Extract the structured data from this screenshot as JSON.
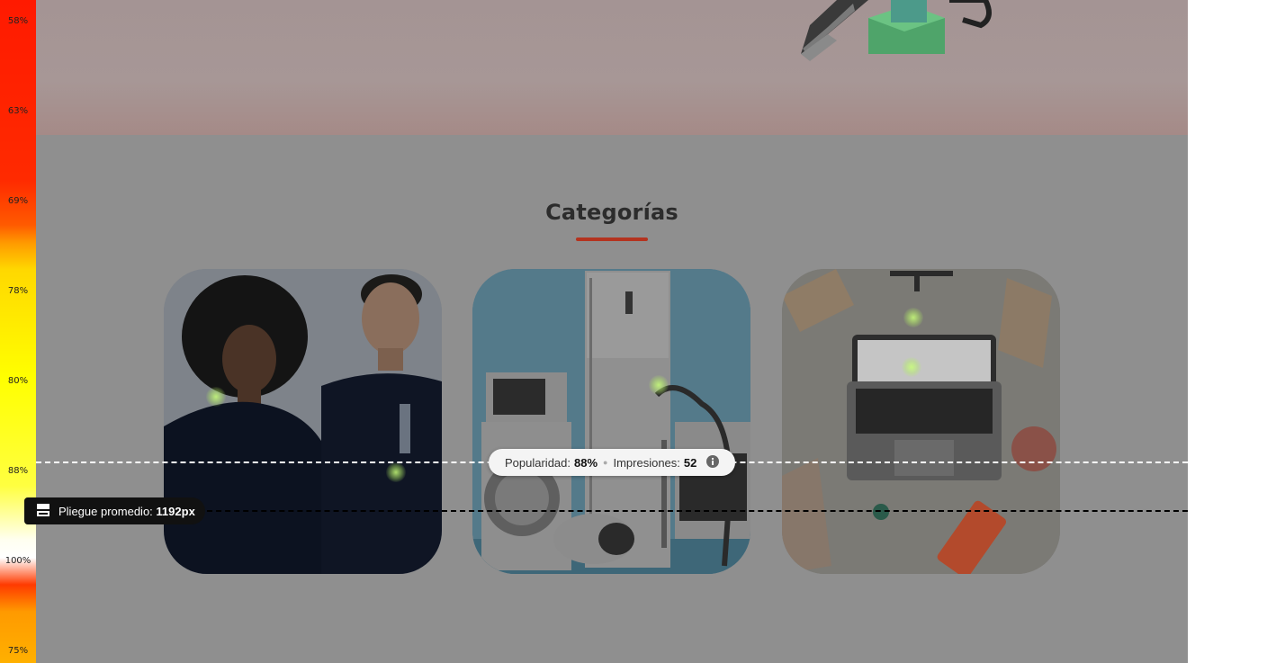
{
  "heatmap_scale": {
    "labels": [
      "58%",
      "63%",
      "69%",
      "78%",
      "80%",
      "88%",
      "100%",
      "75%"
    ]
  },
  "section": {
    "title": "Categorías",
    "accent_color": "#b4331f"
  },
  "categories": [
    {
      "image": "apparel-photo"
    },
    {
      "image": "home-appliances-photo"
    },
    {
      "image": "laptop-electronics-photo"
    }
  ],
  "fold": {
    "label": "Pliegue promedio:",
    "value": "1192px",
    "icon": "fold-icon"
  },
  "stats": {
    "popularity_label": "Popularidad:",
    "popularity_value": "88%",
    "impressions_label": "Impresiones:",
    "impressions_value": "52",
    "info_icon": "info-icon"
  }
}
